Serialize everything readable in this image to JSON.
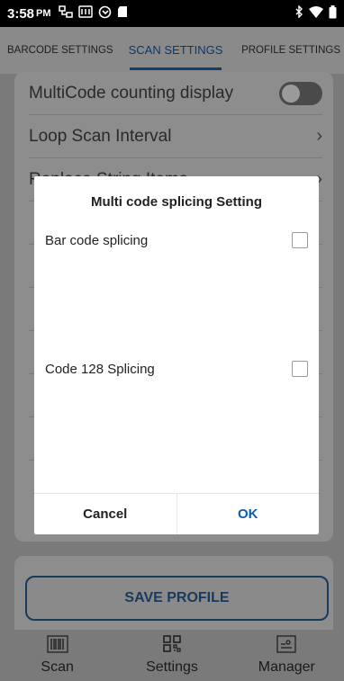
{
  "status_bar": {
    "time": "3:58",
    "ampm": "PM",
    "left_icons": [
      "network-icon",
      "keyboard-icon",
      "sync-icon",
      "sdcard-icon"
    ],
    "right_icons": [
      "bluetooth-icon",
      "wifi-icon",
      "battery-icon"
    ]
  },
  "tabs": [
    {
      "label": "BARCODE SETTINGS",
      "active": false
    },
    {
      "label": "SCAN SETTINGS",
      "active": true
    },
    {
      "label": "PROFILE SETTINGS",
      "active": false
    }
  ],
  "settings": {
    "rows": [
      {
        "label": "MultiCode counting display",
        "control": "toggle",
        "on": false
      },
      {
        "label": "Loop Scan Interval",
        "control": "chevron"
      },
      {
        "label": "Replace String Items",
        "control": "chevron"
      }
    ]
  },
  "dialog": {
    "title": "Multi code splicing Setting",
    "options": [
      {
        "label": "Bar code splicing",
        "checked": false
      },
      {
        "label": "Code 128 Splicing",
        "checked": false
      }
    ],
    "cancel": "Cancel",
    "ok": "OK"
  },
  "save_button": "SAVE PROFILE",
  "bottom_nav": [
    {
      "label": "Scan",
      "icon": "barcode-icon"
    },
    {
      "label": "Settings",
      "icon": "qr-code-icon"
    },
    {
      "label": "Manager",
      "icon": "profile-card-icon"
    }
  ],
  "colors": {
    "accent": "#0b5fa8",
    "tab_active": "#0d3f70",
    "scrim": "#7a7a7a"
  }
}
